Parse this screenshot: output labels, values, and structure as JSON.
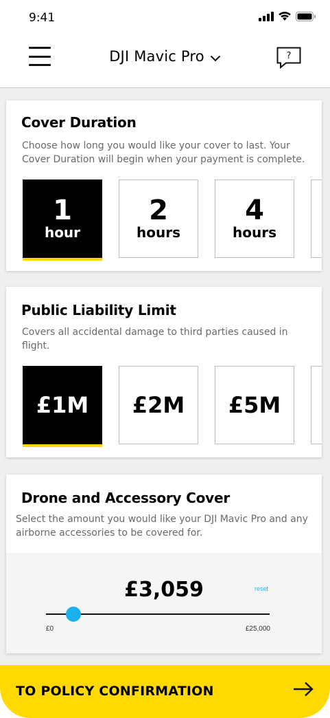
{
  "status": {
    "time": "9:41"
  },
  "nav": {
    "title": "DJI Mavic Pro",
    "help_label": "?"
  },
  "duration": {
    "title": "Cover Duration",
    "description": "Choose how long you would like your cover to last. Your Cover Duration will begin when your payment is complete.",
    "options": [
      {
        "number": "1",
        "unit": "hour",
        "selected": true
      },
      {
        "number": "2",
        "unit": "hours",
        "selected": false
      },
      {
        "number": "4",
        "unit": "hours",
        "selected": false
      }
    ]
  },
  "liability": {
    "title": "Public Liability Limit",
    "description": "Covers all accidental damage to third parties caused in flight.",
    "options": [
      {
        "label": "£1M",
        "selected": true
      },
      {
        "label": "£2M",
        "selected": false
      },
      {
        "label": "£5M",
        "selected": false
      }
    ]
  },
  "drone_cover": {
    "title": "Drone and Accessory Cover",
    "description": "Select the amount you would like your DJI Mavic Pro and any airborne accessories to be covered for.",
    "amount": "£3,059",
    "amount_value": 3059,
    "reset_label": "reset",
    "min_label": "£0",
    "max_label": "£25,000",
    "min_value": 0,
    "max_value": 25000
  },
  "cta": {
    "label": "TO POLICY CONFIRMATION"
  },
  "colors": {
    "accent": "#ffd900",
    "slider": "#1ab0ec",
    "selected_bg": "#000000"
  }
}
